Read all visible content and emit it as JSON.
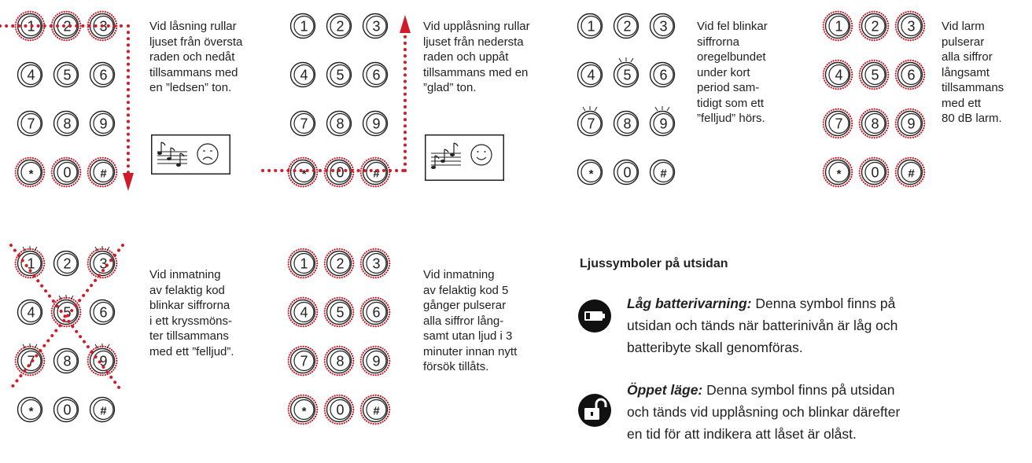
{
  "keypad_keys": [
    [
      "1",
      "2",
      "3"
    ],
    [
      "4",
      "5",
      "6"
    ],
    [
      "7",
      "8",
      "9"
    ],
    [
      "*",
      "0",
      "#"
    ]
  ],
  "colors": {
    "accent": "#d21b29",
    "ink": "#222222"
  },
  "panels": [
    {
      "id": "lock",
      "lines": [
        "Vid låsning rullar",
        "ljuset från översta",
        "raden och nedåt",
        "tillsammans med",
        "en ”ledsen” ton."
      ]
    },
    {
      "id": "unlock",
      "lines": [
        "Vid upplåsning rullar",
        "ljuset från nedersta",
        "raden och uppåt",
        "tillsammans med en",
        "”glad” ton."
      ]
    },
    {
      "id": "error",
      "lines": [
        "Vid fel blinkar",
        "siffrorna",
        "oregelbundet",
        "under kort",
        "period sam-",
        "tidigt som ett",
        "”felljud” hörs."
      ]
    },
    {
      "id": "alarm",
      "lines": [
        "Vid larm",
        "pulserar",
        "alla siffror",
        "långsamt",
        "tillsammans",
        "med ett",
        "80 dB larm."
      ]
    },
    {
      "id": "wrong-code",
      "lines": [
        "Vid inmatning",
        "av felaktig kod",
        "blinkar siffrorna",
        "i ett kryssmöns-",
        "ter tillsammans",
        "med ett ”felljud”."
      ]
    },
    {
      "id": "wrong-code-5",
      "lines": [
        "Vid inmatning",
        "av felaktig kod 5",
        "gånger pulserar",
        "alla siffror lång-",
        "samt utan ljud i 3",
        "minuter innan nytt",
        "försök tillåts."
      ]
    }
  ],
  "section": {
    "heading": "Ljussymboler på utsidan",
    "symbols": [
      {
        "icon": "battery-icon",
        "title": "Låg batterivarning:",
        "lines": [
          "Denna symbol finns på",
          "utsidan och tänds när batterinivån är låg och",
          "batteribyte skall genomföras."
        ]
      },
      {
        "icon": "unlocked-padlock-icon",
        "title": "Öppet läge:",
        "lines": [
          "Denna symbol finns på utsidan",
          "och tänds vid upplåsning och blinkar därefter",
          "en tid för att indikera att låset är olåst."
        ]
      }
    ]
  }
}
